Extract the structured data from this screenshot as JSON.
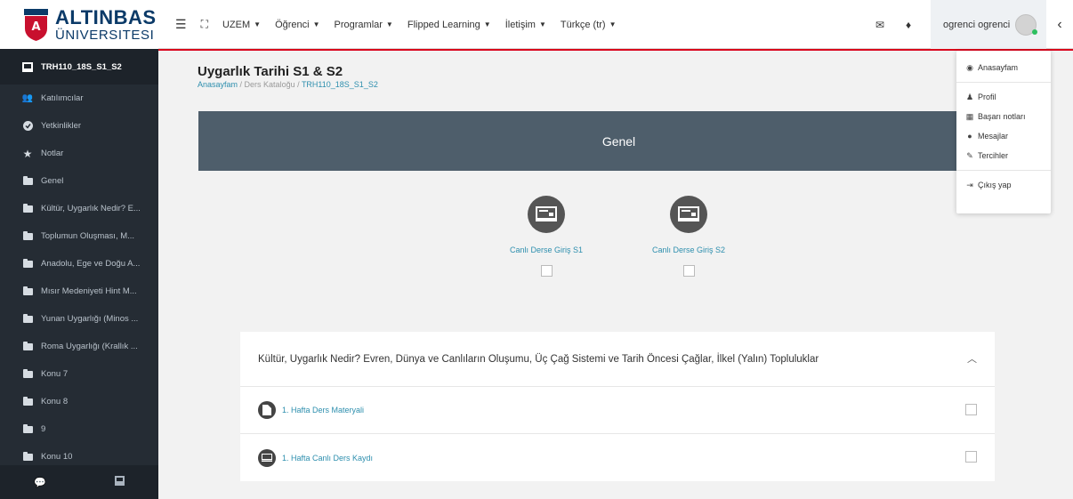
{
  "brand": {
    "main": "ALTINBAS",
    "sub": "ÜNIVERSITESI"
  },
  "nav": {
    "items": [
      {
        "label": "UZEM"
      },
      {
        "label": "Öğrenci"
      },
      {
        "label": "Programlar"
      },
      {
        "label": "Flipped Learning"
      },
      {
        "label": "İletişim"
      },
      {
        "label": "Türkçe (tr)"
      }
    ]
  },
  "user": {
    "name": "ogrenci ogrenci"
  },
  "sidebar": {
    "items": [
      {
        "label": "TRH110_18S_S1_S2"
      },
      {
        "label": "Katılımcılar"
      },
      {
        "label": "Yetkinlikler"
      },
      {
        "label": "Notlar"
      },
      {
        "label": "Genel"
      },
      {
        "label": "Kültür, Uygarlık Nedir? E..."
      },
      {
        "label": "Toplumun Oluşması, M..."
      },
      {
        "label": "Anadolu, Ege ve Doğu A..."
      },
      {
        "label": "Mısır Medeniyeti Hint M..."
      },
      {
        "label": "Yunan Uygarlığı (Minos ..."
      },
      {
        "label": "Roma Uygarlığı (Krallık ..."
      },
      {
        "label": "Konu 7"
      },
      {
        "label": "Konu 8"
      },
      {
        "label": "9"
      },
      {
        "label": "Konu 10"
      }
    ]
  },
  "page": {
    "title": "Uygarlık Tarihi S1 & S2",
    "breadcrumb": [
      "Anasayfam",
      "Ders Kataloğu",
      "TRH110_18S_S1_S2"
    ],
    "breadcrumb_sep": " / "
  },
  "genel": {
    "title": "Genel",
    "activities": [
      {
        "label": "Canlı Derse Giriş S1"
      },
      {
        "label": "Canlı Derse Giriş S2"
      }
    ]
  },
  "section": {
    "title": "Kültür, Uygarlık Nedir? Evren, Dünya ve Canlıların Oluşumu, Üç Çağ Sistemi ve Tarih Öncesi Çağlar, İlkel (Yalın) Topluluklar",
    "rows": [
      {
        "label": "1. Hafta Ders Materyali",
        "icon": "file-icon"
      },
      {
        "label": "1. Hafta Canlı Ders Kaydı",
        "icon": "screen-icon"
      }
    ]
  },
  "user_menu": {
    "items": [
      {
        "label": "Anasayfam",
        "icon": "dashboard-icon"
      },
      {
        "label": "Profil",
        "icon": "user-icon"
      },
      {
        "label": "Başarı notları",
        "icon": "grades-icon"
      },
      {
        "label": "Mesajlar",
        "icon": "message-icon"
      },
      {
        "label": "Tercihler",
        "icon": "wrench-icon"
      },
      {
        "label": "Çıkış yap",
        "icon": "logout-icon"
      }
    ]
  },
  "colors": {
    "accent_red": "#d9001b",
    "sidebar_bg": "#252c34",
    "link": "#2e8fae",
    "banner": "#4e5e6b"
  }
}
